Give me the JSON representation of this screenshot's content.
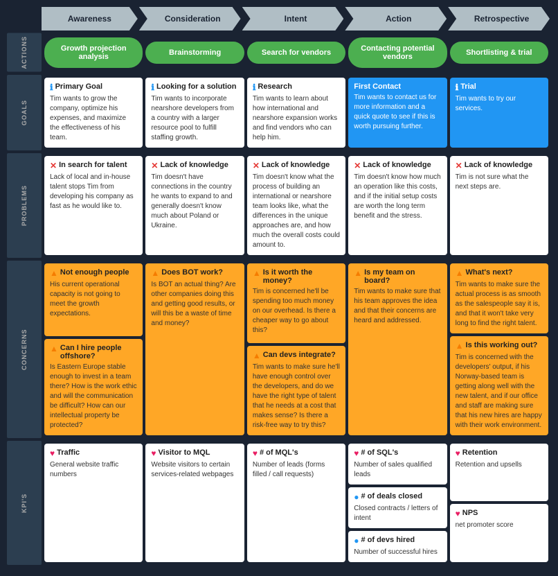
{
  "phases": [
    {
      "label": "Awareness"
    },
    {
      "label": "Consideration"
    },
    {
      "label": "Intent"
    },
    {
      "label": "Action"
    },
    {
      "label": "Retrospective"
    }
  ],
  "actions": {
    "label": "ACTIONS",
    "buttons": [
      {
        "text": "Growth projection analysis",
        "style": "green"
      },
      {
        "text": "Brainstorming",
        "style": "green"
      },
      {
        "text": "Search for vendors",
        "style": "green"
      },
      {
        "text": "Contacting potential vendors",
        "style": "green"
      },
      {
        "text": "Shortlisting & trial",
        "style": "green"
      }
    ]
  },
  "goals": {
    "label": "GOALS",
    "cards": [
      {
        "icon": "ℹ",
        "iconClass": "icon-info",
        "title": "Primary Goal",
        "body": "Tim wants to grow the company, optimize his expenses, and maximize the effectiveness of his team.",
        "style": ""
      },
      {
        "icon": "ℹ",
        "iconClass": "icon-info",
        "title": "Looking for a solution",
        "body": "Tim wants to incorporate nearshore developers from a country with a larger resource pool to fulfill staffing growth.",
        "style": ""
      },
      {
        "icon": "ℹ",
        "iconClass": "icon-info",
        "title": "Research",
        "body": "Tim wants to learn about how international and nearshore expansion works and find vendors who can help him.",
        "style": ""
      },
      {
        "icon": "",
        "iconClass": "",
        "title": "First Contact",
        "body": "Tim wants to contact us for more information and a quick quote to see if this is worth pursuing further.",
        "style": "blue"
      },
      {
        "icon": "ℹ",
        "iconClass": "icon-info",
        "title": "Trial",
        "body": "Tim wants to try our services.",
        "style": "blue"
      }
    ]
  },
  "problems": {
    "label": "PROBLEMS",
    "cards": [
      {
        "icon": "✕",
        "iconClass": "icon-error",
        "title": "In search for talent",
        "body": "Lack of local and in-house talent stops Tim from developing his company as fast as he would like to.",
        "style": ""
      },
      {
        "icon": "✕",
        "iconClass": "icon-error",
        "title": "Lack of knowledge",
        "body": "Tim doesn't have connections in the country he wants to expand to and generally doesn't know much about Poland or Ukraine.",
        "style": ""
      },
      {
        "icon": "✕",
        "iconClass": "icon-error",
        "title": "Lack of knowledge",
        "body": "Tim doesn't know what the process of building an international or nearshore team looks like, what the differences in the unique approaches are, and how much the overall costs could amount to.",
        "style": ""
      },
      {
        "icon": "✕",
        "iconClass": "icon-error",
        "title": "Lack of knowledge",
        "body": "Tim doesn't know how much an operation like this costs, and if the initial setup costs are worth the long term benefit and the stress.",
        "style": ""
      },
      {
        "icon": "✕",
        "iconClass": "icon-error",
        "title": "Lack of knowledge",
        "body": "Tim is not sure what the next steps are.",
        "style": ""
      }
    ]
  },
  "concerns": {
    "label": "CONCERNS",
    "columns": [
      {
        "cards": [
          {
            "icon": "▲",
            "iconClass": "icon-warning",
            "title": "Not enough people",
            "body": "His current operational capacity is not going to meet the growth expectations.",
            "style": "orange"
          },
          {
            "icon": "▲",
            "iconClass": "icon-warning",
            "title": "Can I hire people offshore?",
            "body": "Is Eastern Europe stable enough to invest in a team there? How is the work ethic and will the communication be difficult? How can our intellectual property be protected?",
            "style": "orange"
          }
        ]
      },
      {
        "cards": [
          {
            "icon": "▲",
            "iconClass": "icon-warning",
            "title": "Does BOT work?",
            "body": "Is BOT an actual thing? Are other companies doing this and getting good results, or will this be a waste of time and money?",
            "style": "orange"
          }
        ]
      },
      {
        "cards": [
          {
            "icon": "▲",
            "iconClass": "icon-warning",
            "title": "Is it worth the money?",
            "body": "Tim is concerned he'll be spending too much money on our overhead. Is there a cheaper way to go about this?",
            "style": "orange"
          },
          {
            "icon": "▲",
            "iconClass": "icon-warning",
            "title": "Can devs integrate?",
            "body": "Tim wants to make sure he'll have enough control over the developers, and do we have the right type of talent that he needs at a cost that makes sense? Is there a risk-free way to try this?",
            "style": "orange"
          }
        ]
      },
      {
        "cards": [
          {
            "icon": "▲",
            "iconClass": "icon-warning",
            "title": "Is my team on board?",
            "body": "Tim wants to make sure that his team approves the idea and that their concerns are heard and addressed.",
            "style": "orange"
          }
        ]
      },
      {
        "cards": [
          {
            "icon": "▲",
            "iconClass": "icon-warning",
            "title": "What's next?",
            "body": "Tim wants to make sure the actual process is as smooth as the salespeople say it is, and that it won't take very long to find the right talent.",
            "style": "orange"
          },
          {
            "icon": "▲",
            "iconClass": "icon-warning",
            "title": "Is this working out?",
            "body": "Tim is concerned with the developers' output, if his Norway-based team is getting along well with the new talent, and if our office and staff are making sure that his new hires are happy with their work environment.",
            "style": "orange"
          }
        ]
      }
    ]
  },
  "kpis": {
    "label": "KPI'S",
    "columns": [
      {
        "cards": [
          {
            "icon": "♥",
            "iconClass": "icon-kpi",
            "title": "Traffic",
            "body": "General website traffic numbers",
            "style": ""
          }
        ]
      },
      {
        "cards": [
          {
            "icon": "♥",
            "iconClass": "icon-kpi",
            "title": "Visitor to MQL",
            "body": "Website visitors to certain services-related webpages",
            "style": ""
          }
        ]
      },
      {
        "cards": [
          {
            "icon": "♥",
            "iconClass": "icon-kpi",
            "title": "# of MQL's",
            "body": "Number of leads (forms filled / call requests)",
            "style": ""
          }
        ]
      },
      {
        "cards": [
          {
            "icon": "♥",
            "iconClass": "icon-kpi",
            "title": "# of SQL's",
            "body": "Number of sales qualified leads",
            "style": ""
          },
          {
            "icon": "●",
            "iconClass": "icon-kpi-blue",
            "title": "# of deals closed",
            "body": "Closed contracts / letters of intent",
            "style": ""
          },
          {
            "icon": "●",
            "iconClass": "icon-kpi-blue",
            "title": "# of devs hired",
            "body": "Number of successful hires",
            "style": ""
          }
        ]
      },
      {
        "cards": [
          {
            "icon": "♥",
            "iconClass": "icon-kpi",
            "title": "Retention",
            "body": "Retention and upsells",
            "style": ""
          },
          {
            "icon": "♥",
            "iconClass": "icon-kpi",
            "title": "NPS",
            "body": "net promoter score",
            "style": ""
          }
        ]
      }
    ]
  }
}
